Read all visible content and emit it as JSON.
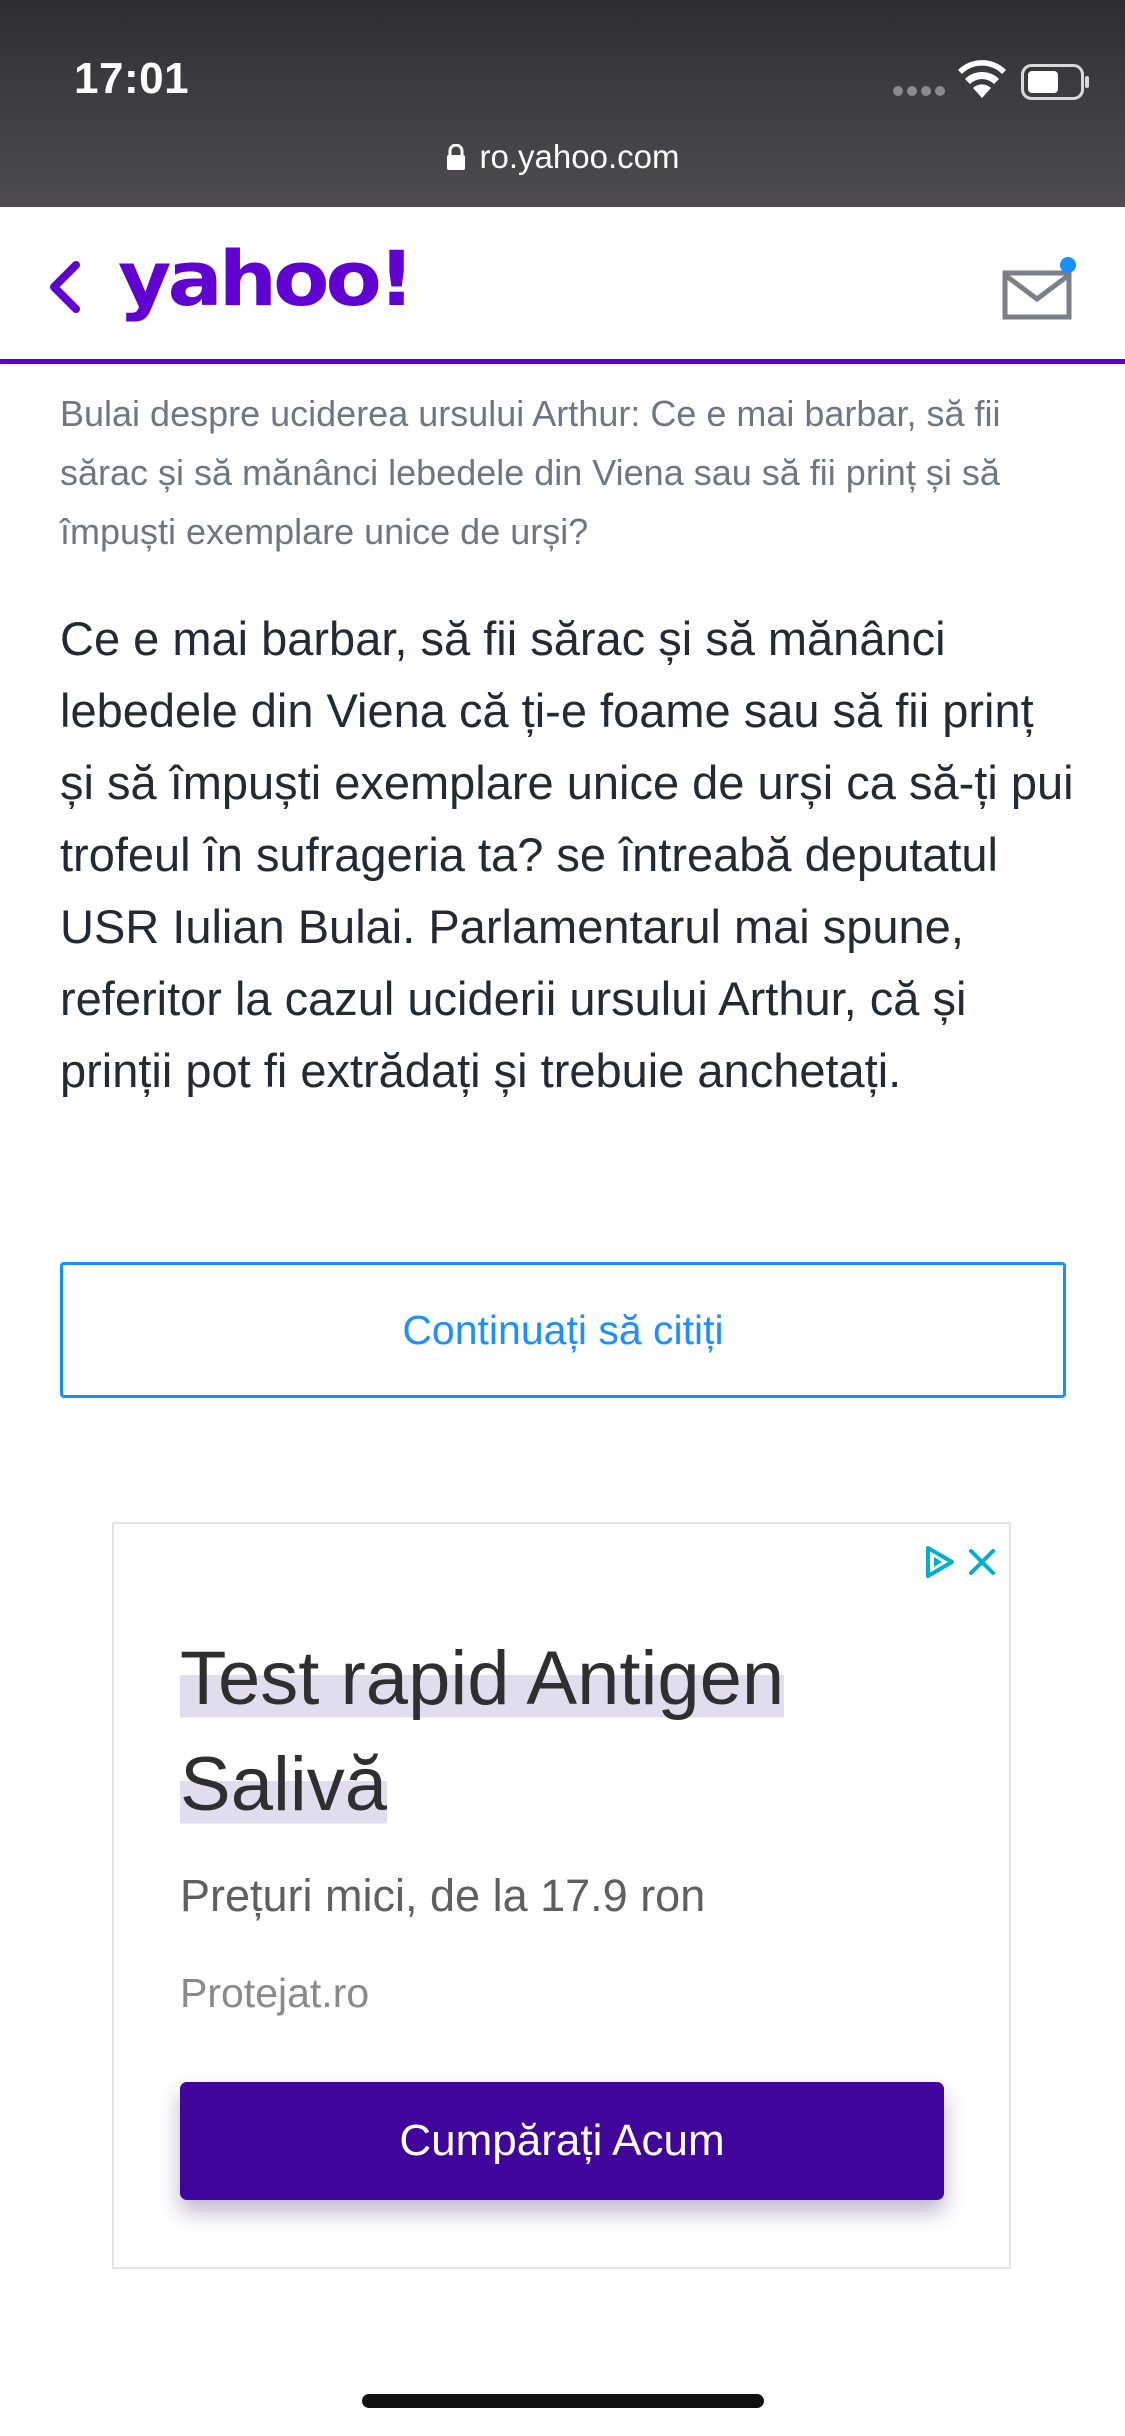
{
  "status_bar": {
    "time": "17:01"
  },
  "browser": {
    "url": "ro.yahoo.com"
  },
  "header": {
    "logo_text": "yahoo!",
    "brand_color": "#6001d2",
    "mail_has_notification": true
  },
  "article": {
    "summary": "Bulai despre uciderea ursului Arthur: Ce e mai barbar, să fii sărac și să mănânci lebedele din Viena sau să fii prinț și să împuști exemplare unice de urși?",
    "body": "Ce e mai barbar, să fii sărac și să mănânci lebedele din Viena că ți-e foame sau să fii prinț și să împuști exemplare unice de urși ca să-ți pui trofeul în sufrageria ta? se întreabă deputatul USR Iulian Bulai. Parlamentarul mai spune, referitor la cazul uciderii ursului Arthur, că și prinții pot fi extrădați și trebuie anchetați.",
    "continue_label": "Continuați să citiți"
  },
  "ad": {
    "title": "Test rapid Antigen Salivă",
    "subtitle": "Prețuri mici, de la 17.9 ron",
    "source": "Protejat.ro",
    "cta_label": "Cumpărați Acum",
    "cta_color": "#40069c"
  },
  "colors": {
    "link_blue": "#1d8fff",
    "body_text": "#232a31",
    "summary_text": "#6e7780"
  }
}
